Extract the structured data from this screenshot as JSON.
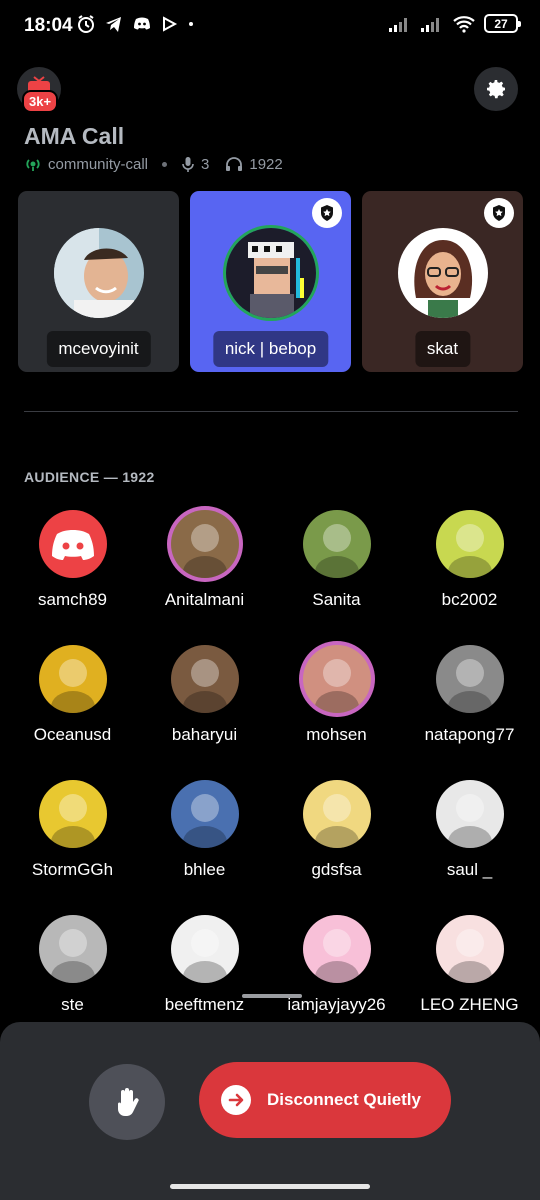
{
  "status_bar": {
    "time": "18:04",
    "battery": "27",
    "icons_left": [
      "alarm-icon",
      "telegram-icon",
      "discord-icon",
      "play-icon",
      "dot-icon"
    ],
    "icons_right": [
      "signal-icon",
      "signal-icon",
      "wifi-icon",
      "battery-icon"
    ]
  },
  "header": {
    "live_count_badge": "3k+",
    "title": "AMA Call",
    "channel": "community-call",
    "speaker_count": "3",
    "listener_count": "1922"
  },
  "speakers": [
    {
      "name": "mcevoyinit",
      "bg": "#2b2d31",
      "moderator": false,
      "speaking": false,
      "avatar_color": "#c9a88f"
    },
    {
      "name": "nick | bebop",
      "bg": "#5865f2",
      "moderator": true,
      "speaking": true,
      "avatar_color": "#1c1c2a"
    },
    {
      "name": "skat",
      "bg": "#3a2724",
      "moderator": true,
      "speaking": false,
      "avatar_color": "#ffffff"
    }
  ],
  "audience": {
    "label": "AUDIENCE — 1922",
    "members": [
      {
        "name": "samch89",
        "color": "#ed4245",
        "ring": false
      },
      {
        "name": "Anitalmani",
        "color": "#8a6a48",
        "ring": true
      },
      {
        "name": "Sanita",
        "color": "#7a9a4a",
        "ring": false
      },
      {
        "name": "bc2002",
        "color": "#c8d850",
        "ring": false
      },
      {
        "name": "Oceanusd",
        "color": "#e0b020",
        "ring": false
      },
      {
        "name": "baharyui",
        "color": "#7a5a40",
        "ring": false
      },
      {
        "name": "mohsen",
        "color": "#d09080",
        "ring": true
      },
      {
        "name": "natapong77",
        "color": "#8a8a8a",
        "ring": false
      },
      {
        "name": "StormGGh",
        "color": "#e8c830",
        "ring": false
      },
      {
        "name": "bhlee",
        "color": "#4a70b0",
        "ring": false
      },
      {
        "name": "gdsfsa",
        "color": "#f0d880",
        "ring": false
      },
      {
        "name": "saul _",
        "color": "#e8e8e8",
        "ring": false
      },
      {
        "name": "ste",
        "color": "#b8b8b8",
        "ring": false
      },
      {
        "name": "beeftmenz",
        "color": "#f0f0f0",
        "ring": false
      },
      {
        "name": "iamjayjayy26",
        "color": "#f8c0d8",
        "ring": false
      },
      {
        "name": "LEO ZHENG",
        "color": "#f8e0e0",
        "ring": false
      }
    ]
  },
  "controls": {
    "raise_hand": "hand-icon",
    "disconnect_label": "Disconnect Quietly"
  }
}
